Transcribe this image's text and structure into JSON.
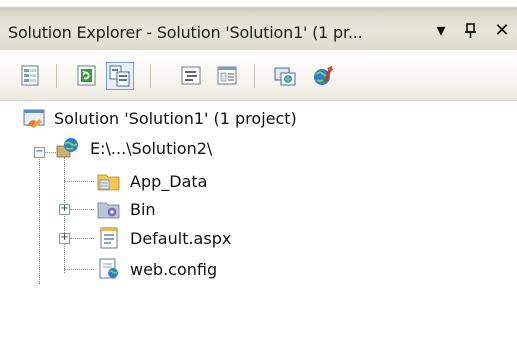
{
  "panel": {
    "title": "Solution Explorer - Solution 'Solution1' (1 pr...",
    "dropdown_glyph": "▾",
    "pin_glyph": "ᵽ",
    "close_glyph": "✕"
  },
  "toolbar": {
    "buttons": [
      {
        "name": "properties-icon"
      },
      {
        "name": "refresh-icon"
      },
      {
        "name": "nest-related-files-icon"
      },
      {
        "name": "view-code-icon"
      },
      {
        "name": "view-designer-icon"
      },
      {
        "name": "copy-website-icon"
      },
      {
        "name": "asp-net-configuration-icon"
      }
    ]
  },
  "tree": {
    "solution_label": "Solution 'Solution1' (1 project)",
    "project_label": "E:\\...\\Solution2\\",
    "items": [
      {
        "label": "App_Data",
        "icon": "folder-icon",
        "expandable": false
      },
      {
        "label": "Bin",
        "icon": "bin-folder-icon",
        "expandable": true
      },
      {
        "label": "Default.aspx",
        "icon": "aspx-file-icon",
        "expandable": true
      },
      {
        "label": "web.config",
        "icon": "config-file-icon",
        "expandable": false
      }
    ]
  },
  "colors": {
    "titlebar": "#e0ddd0",
    "tree_lines": "#8a8a8a",
    "folder": "#f2c94c"
  }
}
